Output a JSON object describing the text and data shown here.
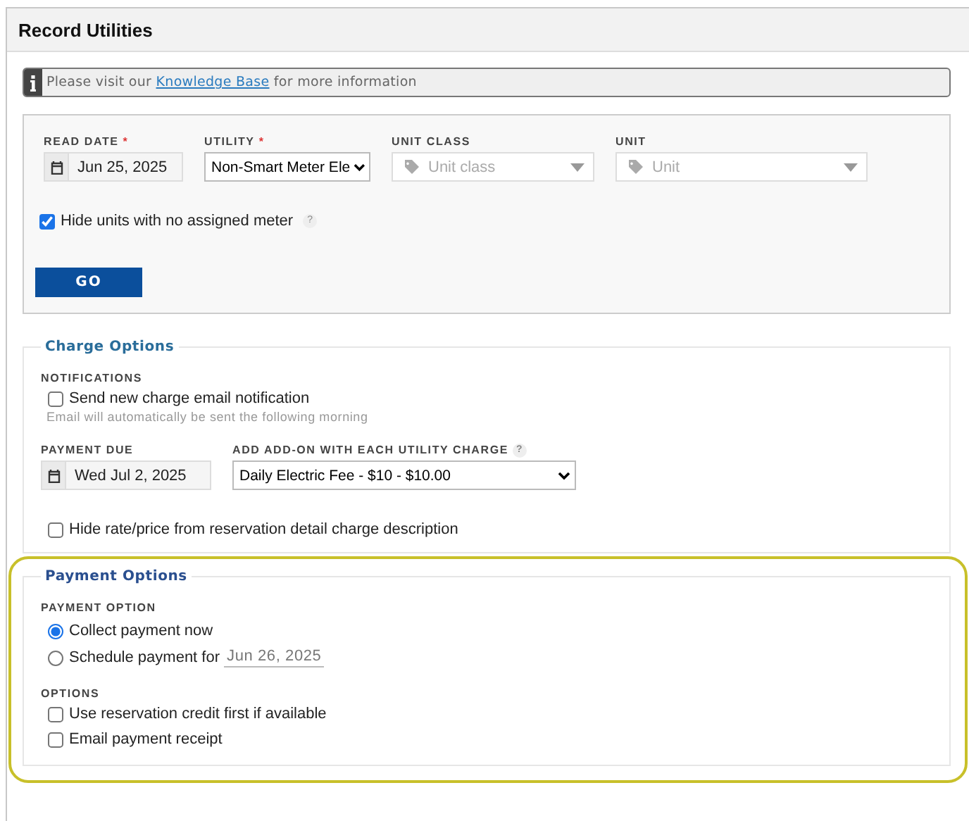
{
  "window": {
    "title": "Record Utilities"
  },
  "info": {
    "before": "Please visit our ",
    "link": "Knowledge Base",
    "after": " for more information"
  },
  "filters": {
    "fields": [
      {
        "kind": "date",
        "label": "READ DATE",
        "required_mark": "*",
        "value": "Jun 25, 2025"
      },
      {
        "kind": "select",
        "label": "UTILITY",
        "required_mark": "*",
        "value": "Non-Smart Meter Ele"
      },
      {
        "kind": "tag-select",
        "label": "UNIT CLASS",
        "placeholder": "Unit class"
      },
      {
        "kind": "tag-select",
        "label": "UNIT",
        "placeholder": "Unit"
      }
    ],
    "hide_units": {
      "label": "Hide units with no assigned meter",
      "checked": true,
      "help": "?"
    },
    "go_button": "GO"
  },
  "charge_options": {
    "legend": "Charge Options",
    "notifications_heading": "NOTIFICATIONS",
    "send_email": {
      "label": "Send new charge email notification",
      "checked": false
    },
    "hint": "Email will automatically be sent the following morning",
    "payment_due": {
      "label": "PAYMENT DUE",
      "value": "Wed Jul 2, 2025"
    },
    "addon": {
      "label": "ADD ADD-ON WITH EACH UTILITY CHARGE",
      "help": "?",
      "value": "Daily Electric Fee - $10 - $10.00"
    },
    "hide_rate": {
      "label": "Hide rate/price from reservation detail charge description",
      "checked": false
    }
  },
  "payment_options": {
    "legend": "Payment Options",
    "heading": "PAYMENT OPTION",
    "choices": [
      {
        "label": "Collect payment now",
        "selected": true
      },
      {
        "label": "Schedule payment for",
        "selected": false,
        "date": "Jun 26, 2025"
      }
    ],
    "options_heading": "OPTIONS",
    "options": [
      {
        "label": "Use reservation credit first if available",
        "checked": false
      },
      {
        "label": "Email payment receipt",
        "checked": false
      }
    ]
  }
}
